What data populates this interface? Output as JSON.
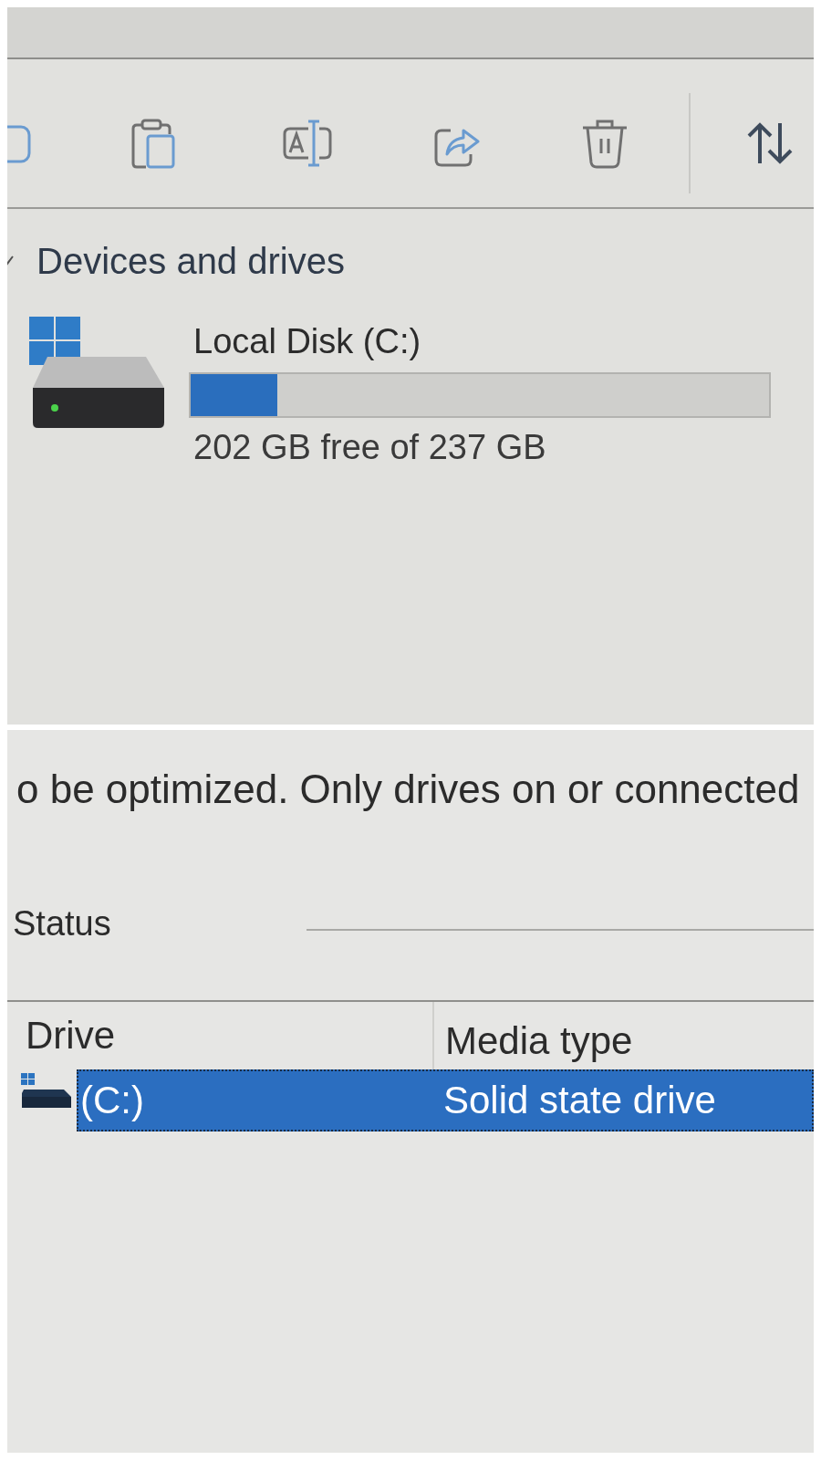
{
  "explorer": {
    "section": {
      "title": "Devices and drives",
      "expanded": true
    },
    "drives": [
      {
        "name": "Local Disk (C:)",
        "level": 0.15,
        "space": "202 GB free of 237 GB"
      }
    ]
  },
  "optimize_drives": {
    "description": "o be optimized. Only drives on or connected",
    "status": {
      "label": "Status"
    },
    "table": {
      "columns": [
        "Drive",
        "Media type"
      ],
      "rows": [
        {
          "cells": [
            "(C:)",
            "Solid state drive"
          ],
          "selected": true
        }
      ]
    }
  }
}
